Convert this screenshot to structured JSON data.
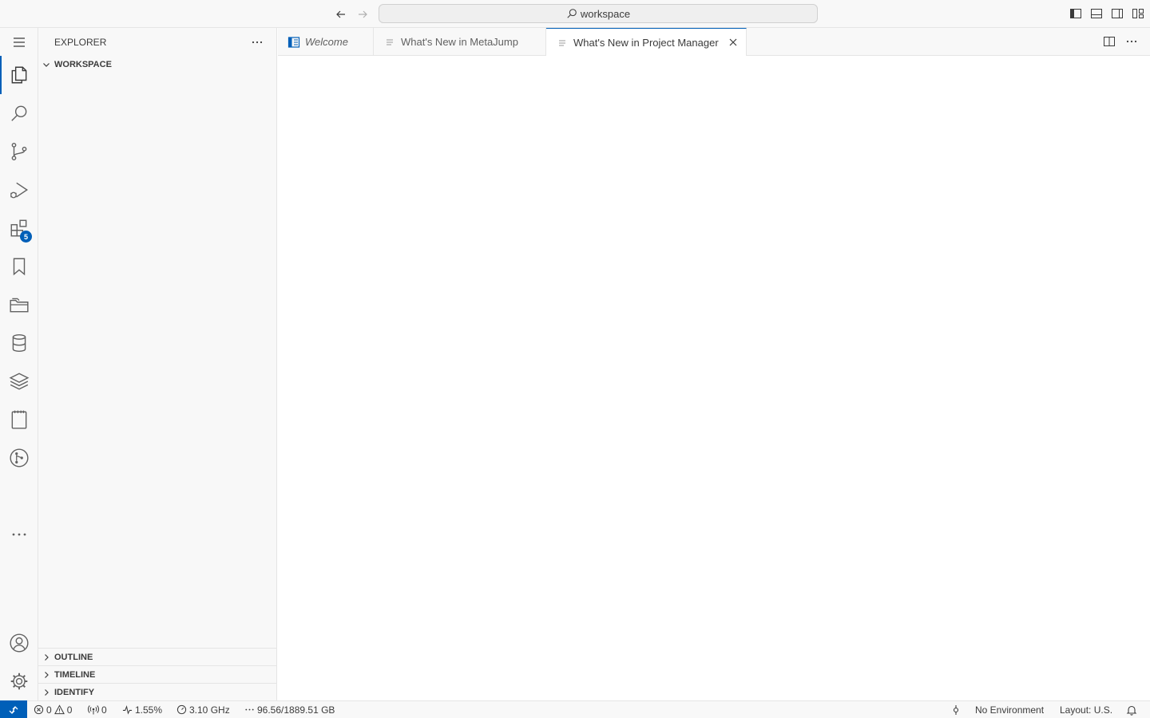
{
  "titlebar": {
    "search_text": "workspace"
  },
  "activitybar": {
    "items": [
      {
        "name": "explorer-icon"
      },
      {
        "name": "search-icon"
      },
      {
        "name": "source-control-icon"
      },
      {
        "name": "run-debug-icon"
      },
      {
        "name": "extensions-icon",
        "badge": "5"
      },
      {
        "name": "bookmark-icon"
      },
      {
        "name": "project-manager-icon"
      },
      {
        "name": "database-icon"
      },
      {
        "name": "layers-icon"
      },
      {
        "name": "notebook-icon"
      },
      {
        "name": "git-graph-icon"
      }
    ]
  },
  "sidebar": {
    "title": "EXPLORER",
    "workspace_section": "WORKSPACE",
    "outline_section": "OUTLINE",
    "timeline_section": "TIMELINE",
    "identify_section": "IDENTIFY"
  },
  "tabs": [
    {
      "label": "Welcome"
    },
    {
      "label": "What's New in MetaJump"
    },
    {
      "label": "What's New in Project Manager"
    }
  ],
  "statusbar": {
    "errors": "0",
    "warnings": "0",
    "ports": "0",
    "cpu": "1.55%",
    "freq": "3.10 GHz",
    "memory": "96.56/1889.51 GB",
    "environment": "No Environment",
    "layout": "Layout: U.S."
  },
  "colors": {
    "accent": "#005fb8",
    "bar_bg": "#f8f8f8",
    "border": "#e5e5e5"
  }
}
